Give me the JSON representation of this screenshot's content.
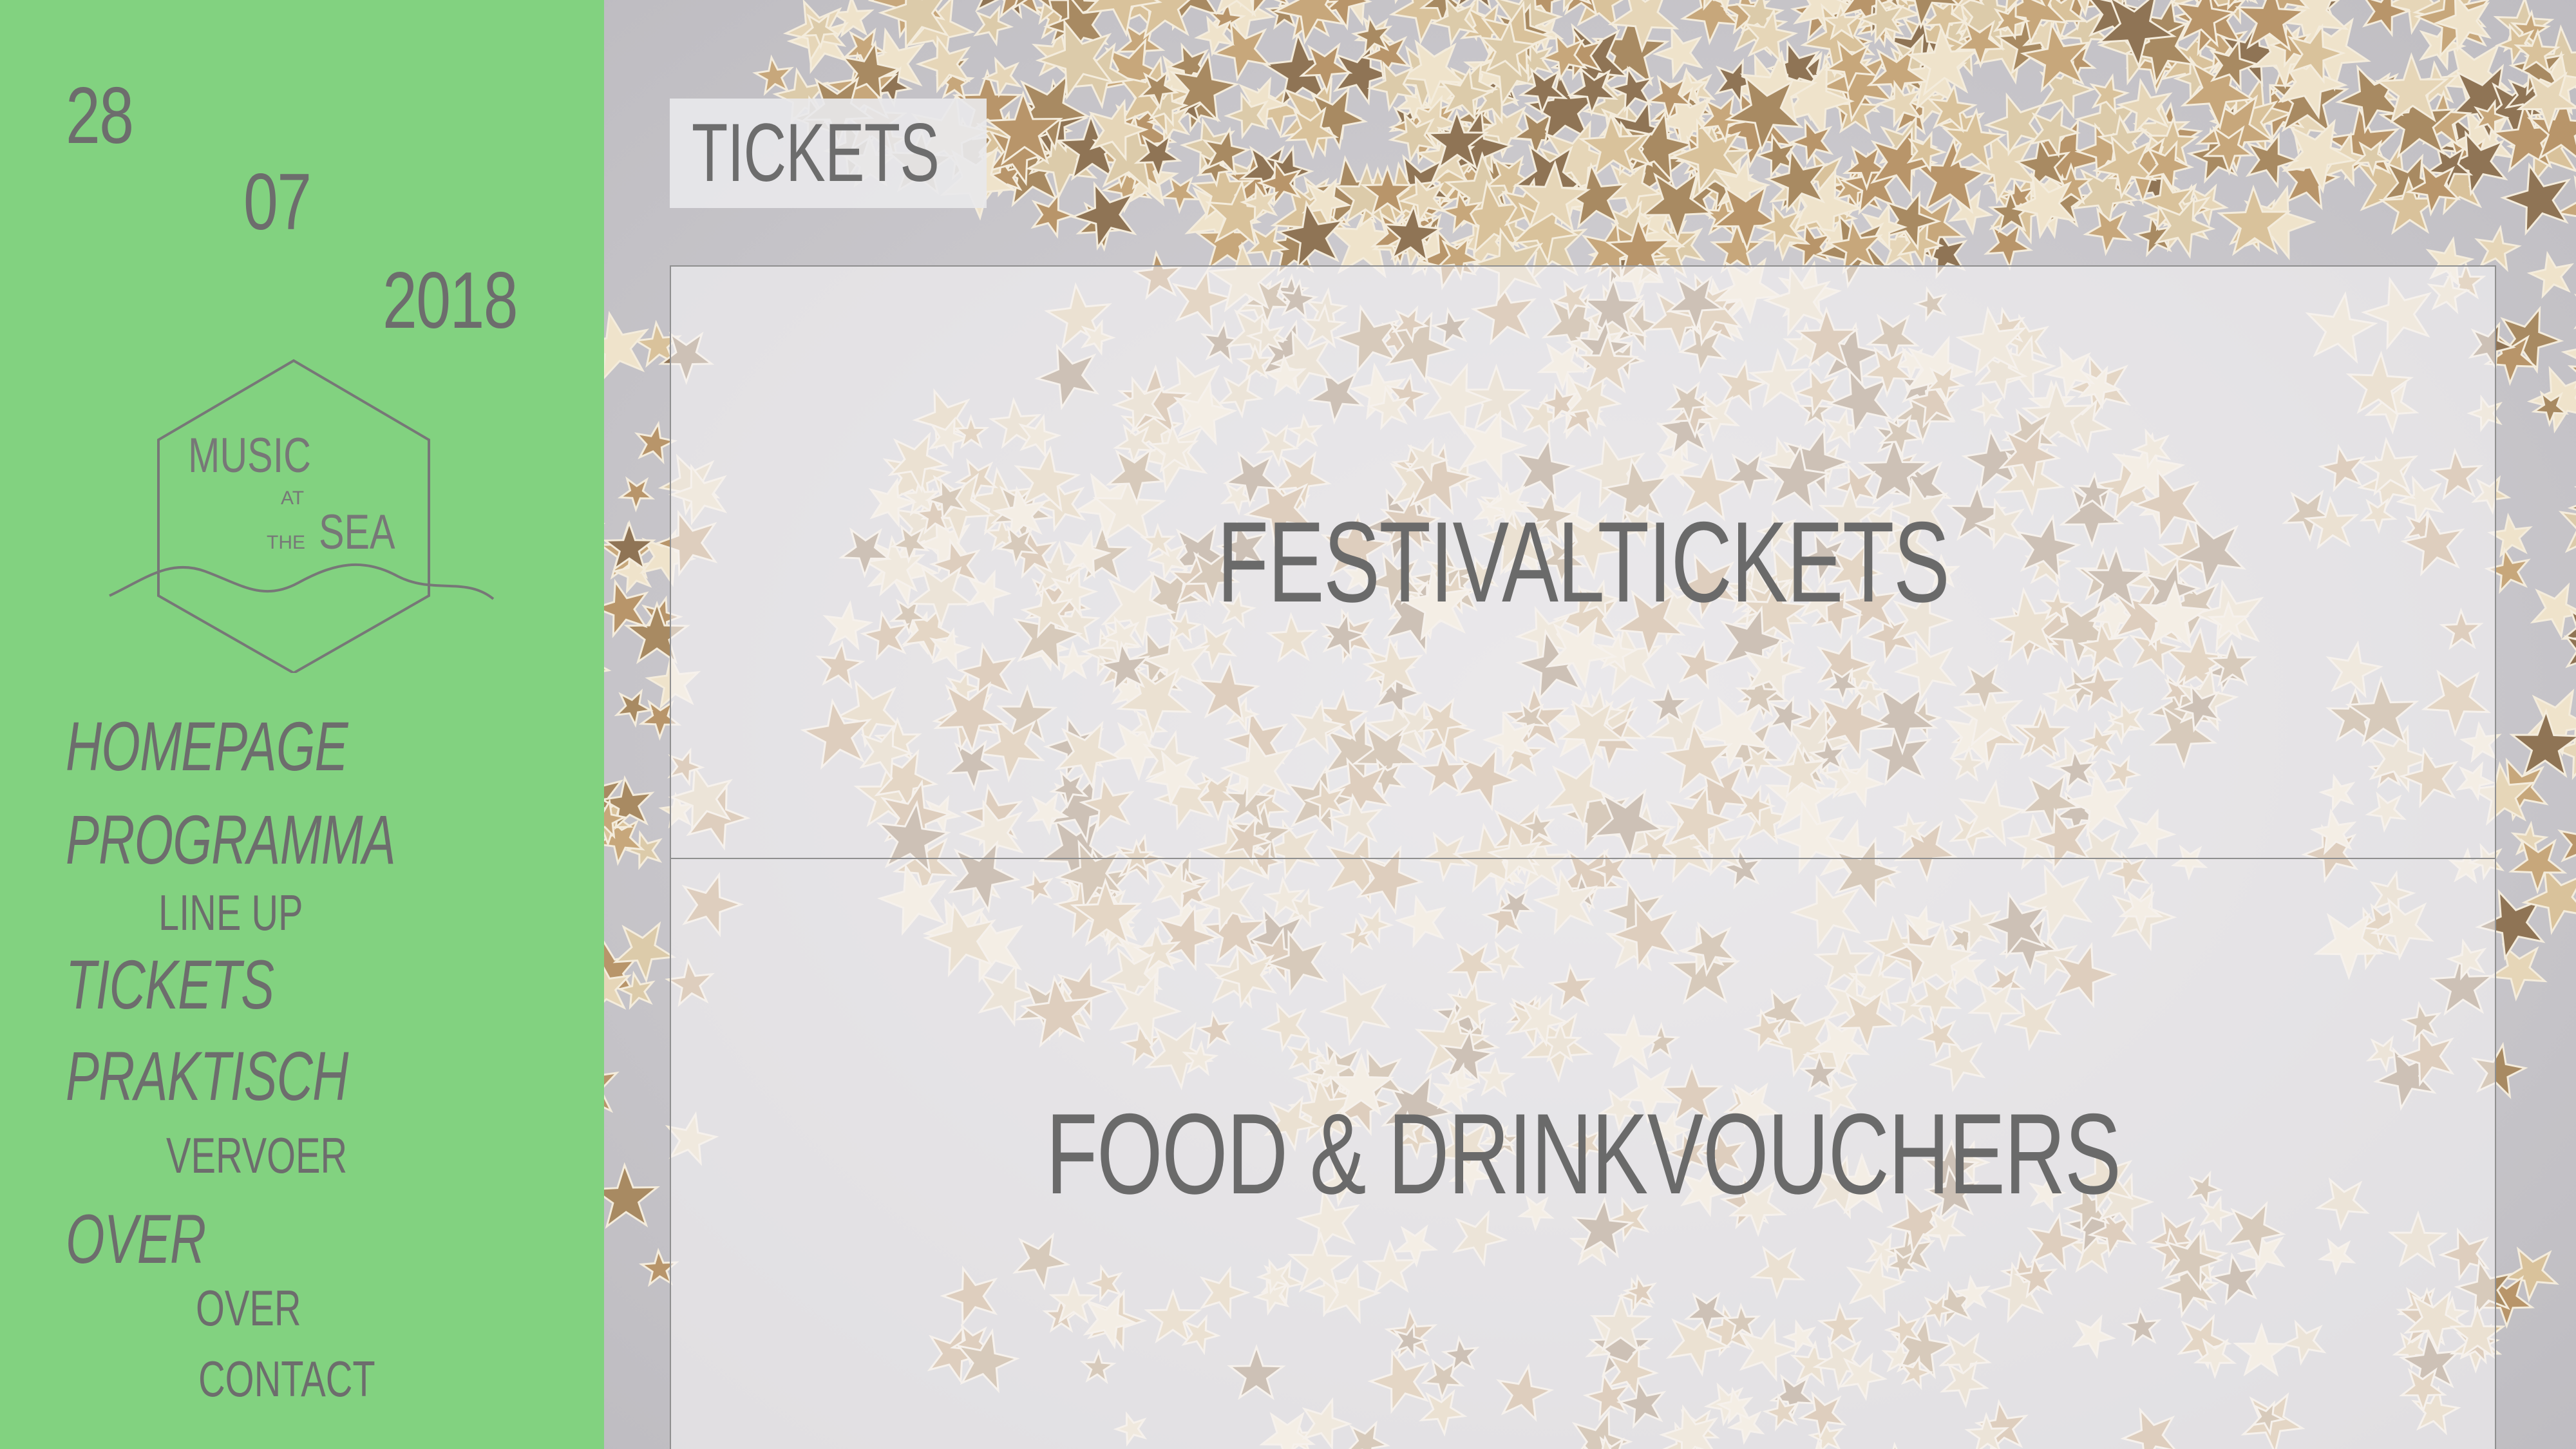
{
  "date": {
    "day": "28",
    "month": "07",
    "year": "2018"
  },
  "logo": {
    "line1": "MUSIC",
    "at": "AT",
    "the": "THE",
    "sea": "SEA"
  },
  "nav": {
    "homepage": "HOMEPAGE",
    "programma": "PROGRAMMA",
    "line_up": "LINE UP",
    "tickets": "TICKETS",
    "praktisch": "PRAKTISCH",
    "vervoer": "VERVOER",
    "over": "OVER",
    "over_sub": "OVER",
    "contact": "CONTACT"
  },
  "main": {
    "page_title": "TICKETS",
    "panels": [
      {
        "label": "FESTIVALTICKETS"
      },
      {
        "label": "FOOD & DRINKVOUCHERS"
      }
    ]
  },
  "colors": {
    "sidebar_bg": "#82d280",
    "text": "#6d6d6d",
    "background": "#c9c7cc",
    "star_gold": "#c9ad86"
  },
  "icons": {
    "background": "gold-star-confetti",
    "logo": "hexagon-wave-logo"
  }
}
